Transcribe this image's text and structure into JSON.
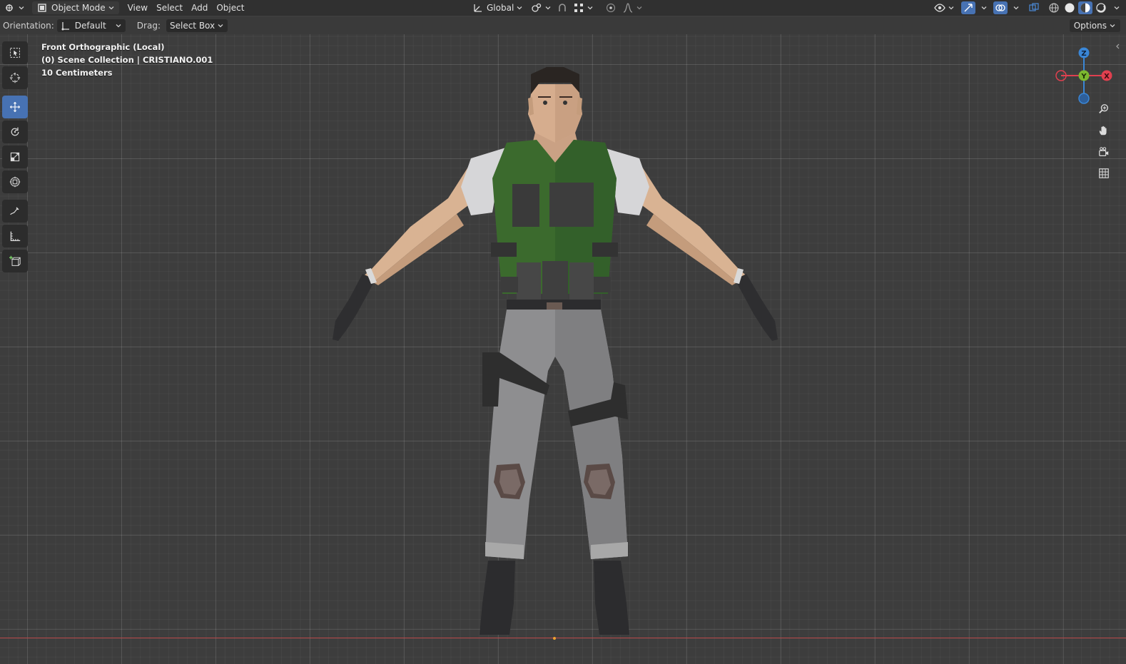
{
  "header": {
    "editor_type_icon": "3d-viewport-icon",
    "mode": "Object Mode",
    "menus": [
      "View",
      "Select",
      "Add",
      "Object"
    ],
    "transform_orientation": "Global",
    "icons_center": [
      "pivot-icon",
      "snap-icon",
      "snap-target-icon",
      "proportional-editing-icon",
      "falloff-icon"
    ],
    "icons_right": [
      "visibility-icon",
      "gizmo-icon",
      "overlay-icon",
      "xray-icon",
      "wireframe-shading-icon",
      "solid-shading-icon",
      "material-shading-icon",
      "rendered-shading-icon"
    ]
  },
  "tool_settings": {
    "orientation_label": "Orientation:",
    "orientation_value": "Default",
    "drag_label": "Drag:",
    "drag_value": "Select Box",
    "options_label": "Options"
  },
  "viewport": {
    "view_name": "Front Orthographic (Local)",
    "collection_info": "(0) Scene Collection | CRISTIANO.001",
    "grid_scale": "10 Centimeters"
  },
  "gizmo": {
    "z_label": "Z",
    "y_label": "Y",
    "x_label": "X",
    "colors": {
      "x": "#e0404f",
      "y": "#7cb82f",
      "z": "#3a86d6"
    }
  },
  "tools": [
    "select-box-icon",
    "cursor-icon",
    "move-icon",
    "rotate-icon",
    "scale-icon",
    "transform-icon",
    "annotate-icon",
    "measure-icon",
    "add-cube-icon"
  ],
  "colors": {
    "active_tool": "#4772b3",
    "vest": "#3b6a2d",
    "skin": "#d8b394",
    "pants": "#8f8f8f"
  }
}
